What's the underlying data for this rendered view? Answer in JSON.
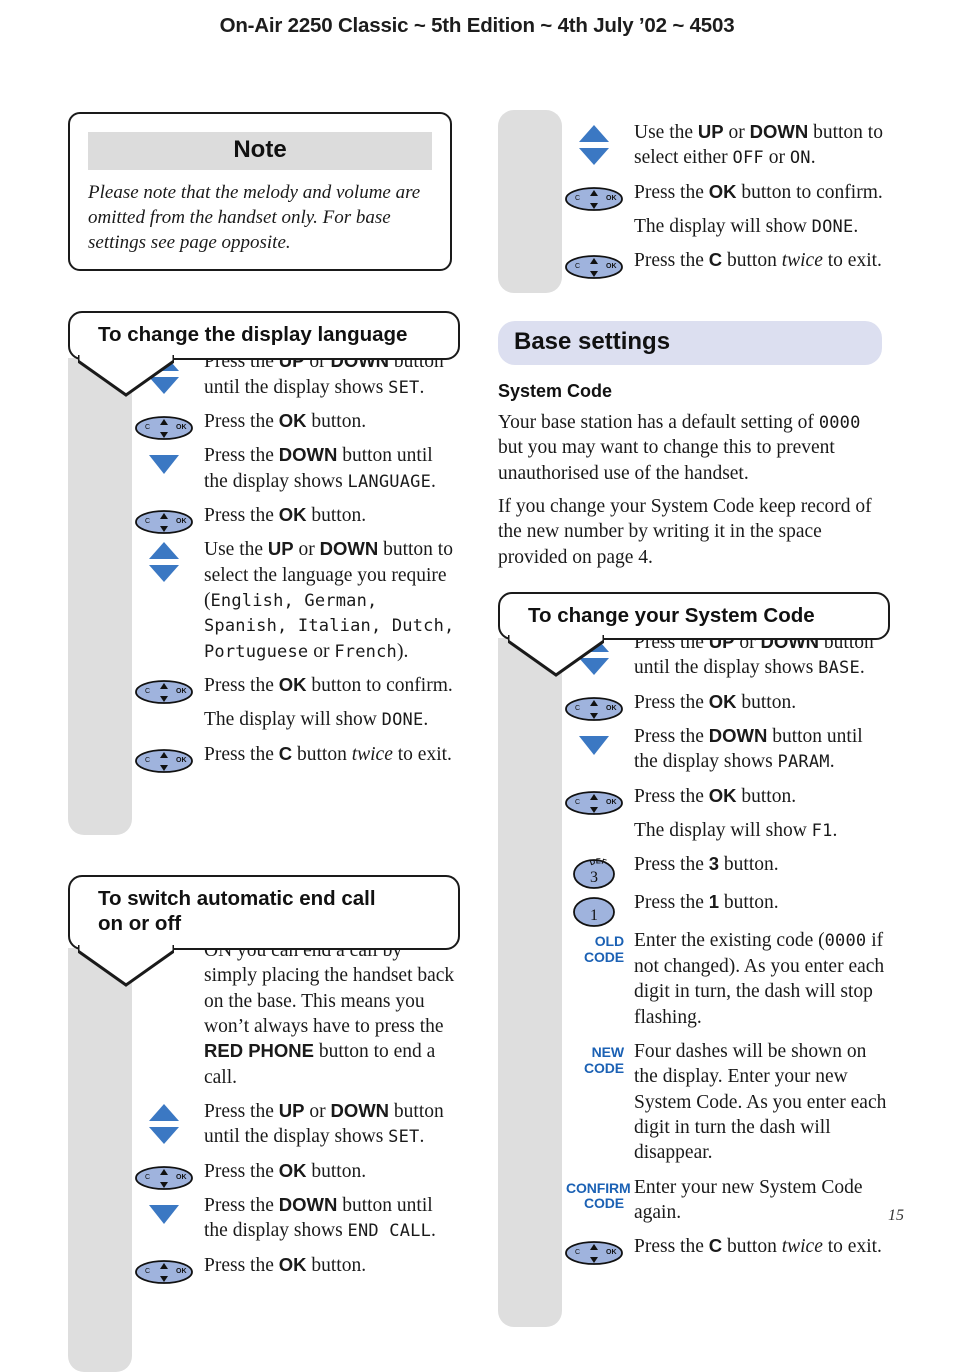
{
  "header": {
    "title": "On-Air 2250 Classic ~ 5th Edition ~ 4th July ’02 ~ 4503"
  },
  "colors": {
    "rail_gray": "#dedede",
    "note_bar_gray": "#dcdcdc",
    "banner_lavender": "#dcdff0",
    "arrow_blue": "#3b78c3",
    "key_blue": "#9fb3dd",
    "code_label_blue": "#1b61b4",
    "ink": "#1a1a1a"
  },
  "note": {
    "title": "Note",
    "body": "Please note that the melody and volume are omitted from the handset only. For base settings see page opposite."
  },
  "language_section": {
    "heading": "To change the display language",
    "steps": [
      {
        "icon": "up-down-arrows-icon",
        "text_html": "Press the <b>UP</b> or <b>DOWN</b> button until the display shows <span class=\"lcd\">SET</span>."
      },
      {
        "icon": "ok-keypad-icon",
        "text_html": "Press the <b>OK</b> button."
      },
      {
        "icon": "down-arrow-icon",
        "text_html": "Press the <b>DOWN</b> button until the display shows <span class=\"lcd\">LANGUAGE</span>."
      },
      {
        "icon": "ok-keypad-icon",
        "text_html": "Press the <b>OK</b> button."
      },
      {
        "icon": "up-down-arrows-icon",
        "text_html": "Use the <b>UP</b> or <b>DOWN</b> button to select the language you require (<span class=\"lcd\">English, German, Spanish, Italian, Dutch, Portuguese</span> or <span class=\"lcd\">French</span>)."
      },
      {
        "icon": "ok-keypad-icon",
        "text_html": "Press the <b>OK</b> button to confirm."
      },
      {
        "icon": "none",
        "text_html": "The display will show <span class=\"lcd\">DONE</span>."
      },
      {
        "icon": "ok-keypad-icon",
        "text_html": "Press the <b>C</b> button <span class=\"it\">twice</span> to exit."
      }
    ]
  },
  "endcall_section": {
    "heading_line1": "To switch automatic end call",
    "heading_line2": "on or off",
    "steps": [
      {
        "icon": "none",
        "text_html": "If you switch automatic end call ON you can end a call by simply placing the handset back on the base. This means you won’t always have to press the <b>RED PHONE</b> button to end a call."
      },
      {
        "icon": "up-down-arrows-icon",
        "text_html": "Press the <b>UP</b> or <b>DOWN</b> button until the display shows <span class=\"lcd\">SET</span>."
      },
      {
        "icon": "ok-keypad-icon",
        "text_html": "Press the <b>OK</b> button."
      },
      {
        "icon": "down-arrow-icon",
        "text_html": "Press the <b>DOWN</b> button until the display shows <span class=\"lcd\">END CALL</span>."
      },
      {
        "icon": "ok-keypad-icon",
        "text_html": "Press the <b>OK</b> button."
      }
    ]
  },
  "endcall_continued": {
    "steps": [
      {
        "icon": "up-down-arrows-icon",
        "text_html": "Use the <b>UP</b> or <b>DOWN</b> button to select either <span class=\"lcd\">OFF</span> or <span class=\"lcd\">ON</span>."
      },
      {
        "icon": "ok-keypad-icon",
        "text_html": "Press the <b>OK</b> button to confirm."
      },
      {
        "icon": "none",
        "text_html": "The display will show <span class=\"lcd\">DONE</span>."
      },
      {
        "icon": "ok-keypad-icon",
        "text_html": "Press the <b>C</b> button <span class=\"it\">twice</span> to exit."
      }
    ]
  },
  "base_settings": {
    "banner_title": "Base settings",
    "subhead": "System Code",
    "paragraphs": [
      "Your base station has a default setting of <span class=\"lcd\">0000</span> but you may want to change this to prevent unauthorised use of the handset.",
      "If you change your System Code keep record of the new number by writing it in the space provided on page 4."
    ]
  },
  "syscode_section": {
    "heading": "To change your System Code",
    "steps": [
      {
        "icon": "up-down-arrows-icon",
        "text_html": "Press the <b>UP</b> or <b>DOWN</b> button until the display shows <span class=\"lcd\">BASE</span>."
      },
      {
        "icon": "ok-keypad-icon",
        "text_html": "Press the <b>OK</b> button."
      },
      {
        "icon": "down-arrow-icon",
        "text_html": "Press the <b>DOWN</b> button until the display shows <span class=\"lcd\">PARAM</span>."
      },
      {
        "icon": "ok-keypad-icon",
        "text_html": "Press the <b>OK</b> button."
      },
      {
        "icon": "none",
        "text_html": "The display will show <span class=\"lcd\">F1</span>."
      },
      {
        "icon": "key-3-icon",
        "key_digit": "3",
        "key_letters": "DEF",
        "text_html": "Press the <b>3</b> button."
      },
      {
        "icon": "key-1-icon",
        "key_digit": "1",
        "key_letters": "",
        "text_html": "Press the <b>1</b> button."
      },
      {
        "icon": "code-label",
        "label_line1": "OLD",
        "label_line2": "CODE",
        "text_html": "Enter the existing code (<span class=\"lcd\">0000</span> if not changed). As you enter each digit in turn, the dash will stop flashing."
      },
      {
        "icon": "code-label",
        "label_line1": "NEW",
        "label_line2": "CODE",
        "text_html": "Four dashes will be shown on the display. Enter your new System Code. As you enter each digit in turn the dash will disappear."
      },
      {
        "icon": "code-label",
        "label_line1": "CONFIRM",
        "label_line2": "CODE",
        "text_html": "Enter your new System Code again."
      },
      {
        "icon": "ok-keypad-icon",
        "text_html": "Press the <b>C</b> button <span class=\"it\">twice</span> to exit."
      }
    ]
  },
  "footer": {
    "page_number": "15"
  }
}
